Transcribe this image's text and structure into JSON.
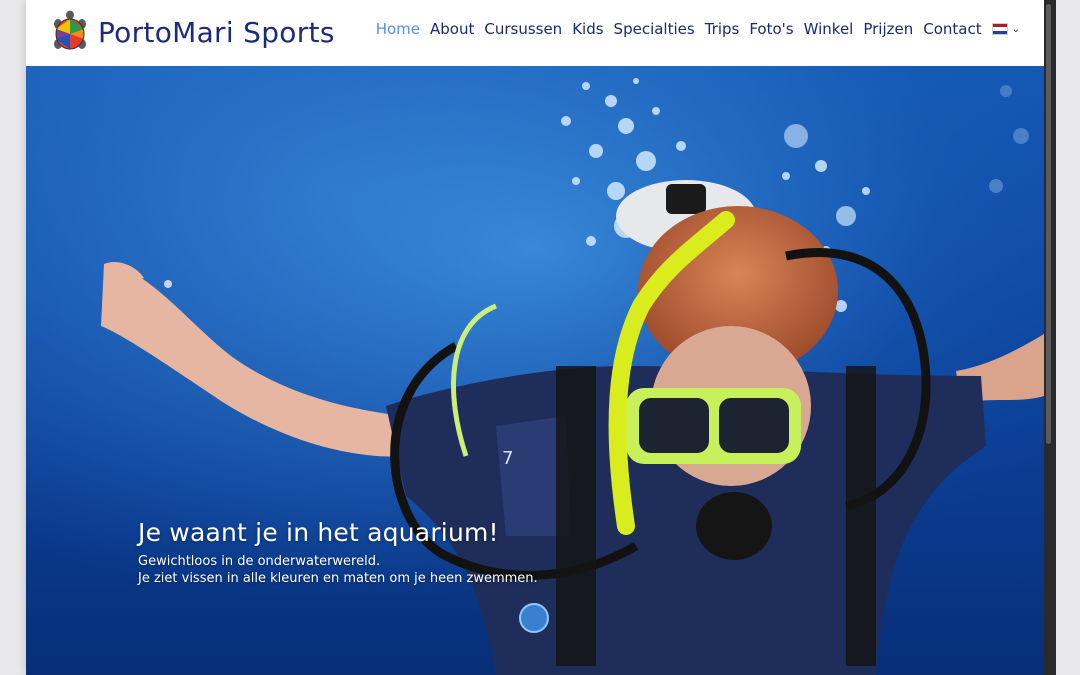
{
  "site": {
    "brand": "PortoMari Sports"
  },
  "nav": {
    "items": [
      {
        "label": "Home",
        "active": true
      },
      {
        "label": "About"
      },
      {
        "label": "Cursussen"
      },
      {
        "label": "Kids"
      },
      {
        "label": "Specialties"
      },
      {
        "label": "Trips"
      },
      {
        "label": "Foto's"
      },
      {
        "label": "Winkel"
      },
      {
        "label": "Prijzen"
      },
      {
        "label": "Contact"
      }
    ],
    "language_icon": "netherlands-flag-icon",
    "active_color": "#5b8ee6",
    "link_color": "#1a2a6b"
  },
  "hero": {
    "title": "Je waant je in het aquarium!",
    "line1": "Gewichtloos in de onderwaterwereld.",
    "line2": "Je ziet vissen in alle kleuren en maten om je heen zwemmen."
  }
}
